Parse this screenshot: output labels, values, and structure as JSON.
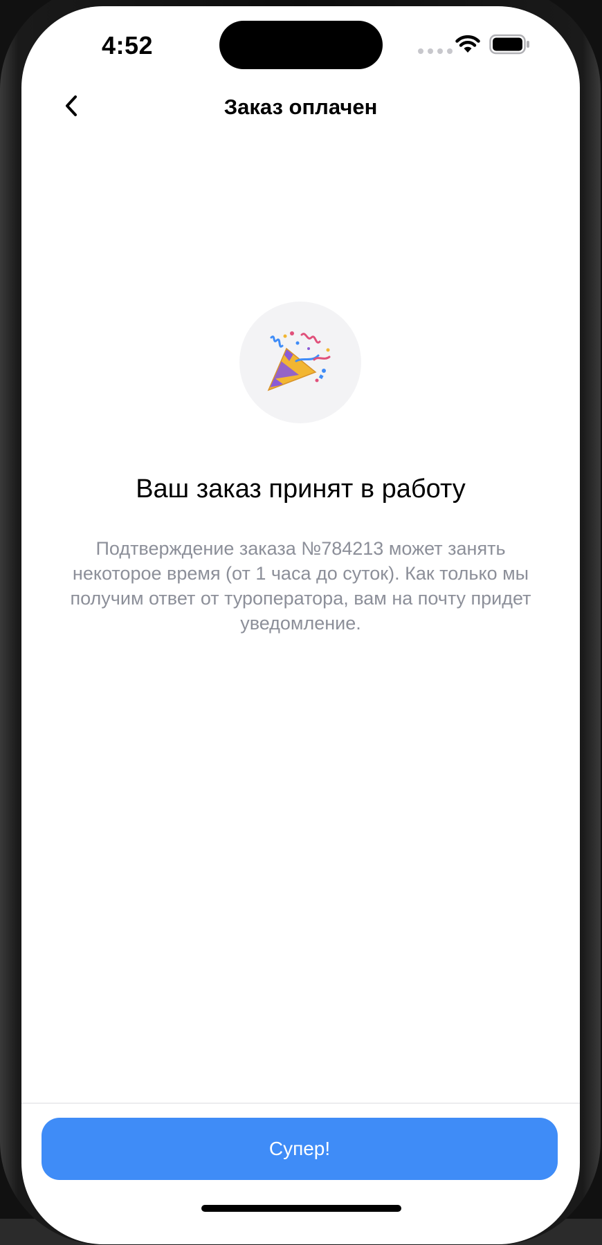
{
  "status_bar": {
    "time": "4:52",
    "icons": [
      "signal-dots-icon",
      "wifi-icon",
      "battery-icon"
    ]
  },
  "nav": {
    "back_icon": "chevron-left-icon",
    "title": "Заказ оплачен"
  },
  "content": {
    "illustration_icon": "party-popper-icon",
    "headline": "Ваш заказ принят в работу",
    "description": "Подтверждение заказа №784213 может занять некоторое время (от 1 часа до суток). Как только мы получим ответ от туроператора, вам на почту придет уведомление."
  },
  "footer": {
    "primary_button_label": "Супер!"
  },
  "colors": {
    "accent": "#3f8cf7",
    "description_text": "#8c8f99",
    "illustration_bg": "#f3f3f5"
  }
}
